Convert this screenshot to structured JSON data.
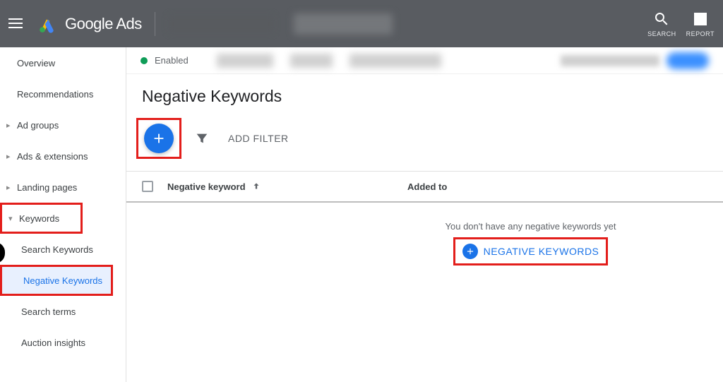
{
  "header": {
    "product_name": "Google Ads",
    "search_label": "SEARCH",
    "reports_label": "REPORT"
  },
  "sidebar": {
    "items": [
      {
        "label": "Overview",
        "expandable": false
      },
      {
        "label": "Recommendations",
        "expandable": false
      },
      {
        "label": "Ad groups",
        "expandable": true
      },
      {
        "label": "Ads & extensions",
        "expandable": true
      },
      {
        "label": "Landing pages",
        "expandable": true
      },
      {
        "label": "Keywords",
        "expandable": true,
        "highlighted": true
      },
      {
        "label": "Search Keywords",
        "sub": true
      },
      {
        "label": "Negative Keywords",
        "sub": true,
        "selected": true,
        "highlighted": true
      },
      {
        "label": "Search terms",
        "sub": true
      },
      {
        "label": "Auction insights",
        "sub": true
      }
    ]
  },
  "status": {
    "label": "Enabled",
    "color": "#0f9d58"
  },
  "page": {
    "title": "Negative Keywords",
    "add_filter_label": "ADD FILTER"
  },
  "table": {
    "columns": {
      "neg_kw": "Negative keyword",
      "added_to": "Added to"
    }
  },
  "empty_state": {
    "text": "You don't have any negative keywords yet",
    "button_label": "NEGATIVE KEYWORDS"
  }
}
